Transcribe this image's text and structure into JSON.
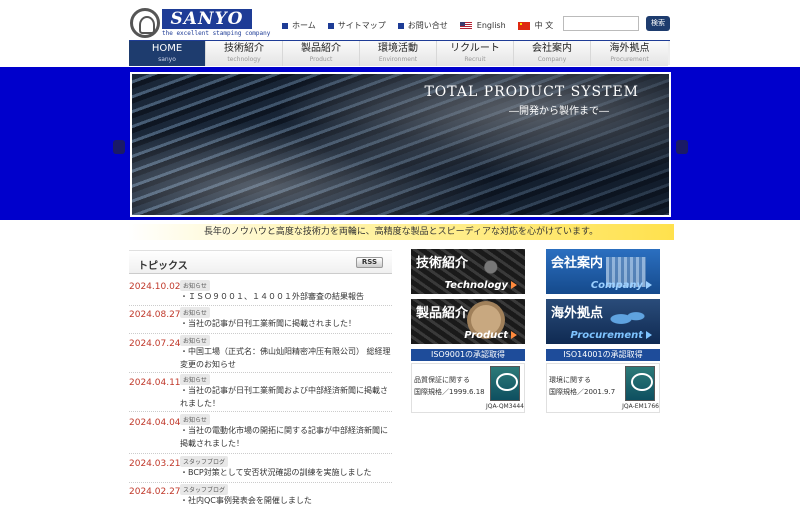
{
  "header": {
    "logo_text": "SANYO",
    "logo_tagline": "the excellent stamping company",
    "links": [
      {
        "label": "ホーム"
      },
      {
        "label": "サイトマップ"
      },
      {
        "label": "お問い合せ"
      }
    ],
    "lang_en": "English",
    "lang_cn": "中 文",
    "search_placeholder": "",
    "search_button": "検索"
  },
  "nav": [
    {
      "jp": "HOME",
      "en": "sanyo"
    },
    {
      "jp": "技術紹介",
      "en": "technology"
    },
    {
      "jp": "製品紹介",
      "en": "Product"
    },
    {
      "jp": "環境活動",
      "en": "Environment"
    },
    {
      "jp": "リクルート",
      "en": "Recruit"
    },
    {
      "jp": "会社案内",
      "en": "Company"
    },
    {
      "jp": "海外拠点",
      "en": "Procurement"
    }
  ],
  "hero": {
    "title": "TOTAL PRODUCT SYSTEM",
    "subtitle": "―開発から製作まで―"
  },
  "tagline": "長年のノウハウと高度な技術力を両輪に、高精度な製品とスピーディアな対応を心がけています。",
  "topics": {
    "title": "トピックス",
    "rss": "RSS",
    "items": [
      {
        "date": "2024.10.02",
        "category": "お知らせ",
        "text": "ＩＳＯ９００１、１４００１外部審査の結果報告"
      },
      {
        "date": "2024.08.27",
        "category": "お知らせ",
        "text": "当社の記事が日刊工業新聞に掲載されました！"
      },
      {
        "date": "2024.07.24",
        "category": "お知らせ",
        "text": "中国工場（正式名：佛山灿阳精密冲压有限公司） 総経理変更のお知らせ"
      },
      {
        "date": "2024.04.11",
        "category": "お知らせ",
        "text": "当社の記事が日刊工業新聞および中部経済新聞に掲載されました！"
      },
      {
        "date": "2024.04.04",
        "category": "お知らせ",
        "text": "当社の電動化市場の開拓に関する記事が中部経済新聞に掲載されました！"
      },
      {
        "date": "2024.03.21",
        "category": "スタッフブログ",
        "text": "BCP対策として安否状況確認の訓練を実施しました"
      },
      {
        "date": "2024.02.27",
        "category": "スタッフブログ",
        "text": "社内QC事例発表会を開催しました"
      }
    ]
  },
  "banners": [
    {
      "jp": "技術紹介",
      "en": "Technology"
    },
    {
      "jp": "会社案内",
      "en": "Company"
    },
    {
      "jp": "製品紹介",
      "en": "Product"
    },
    {
      "jp": "海外拠点",
      "en": "Procurement"
    }
  ],
  "iso": [
    {
      "head": "ISO9001の承認取得",
      "line1": "品質保証に関する",
      "line2": "国際規格／1999.6.18",
      "code": "JQA-QM3444"
    },
    {
      "head": "ISO14001の承認取得",
      "line1": "環境に関する",
      "line2": "国際規格／2001.9.7",
      "code": "JQA-EM1766"
    }
  ],
  "colors": {
    "brand_blue": "#1e3c96",
    "hero_band": "#0000cc",
    "date_red": "#c0392b"
  }
}
